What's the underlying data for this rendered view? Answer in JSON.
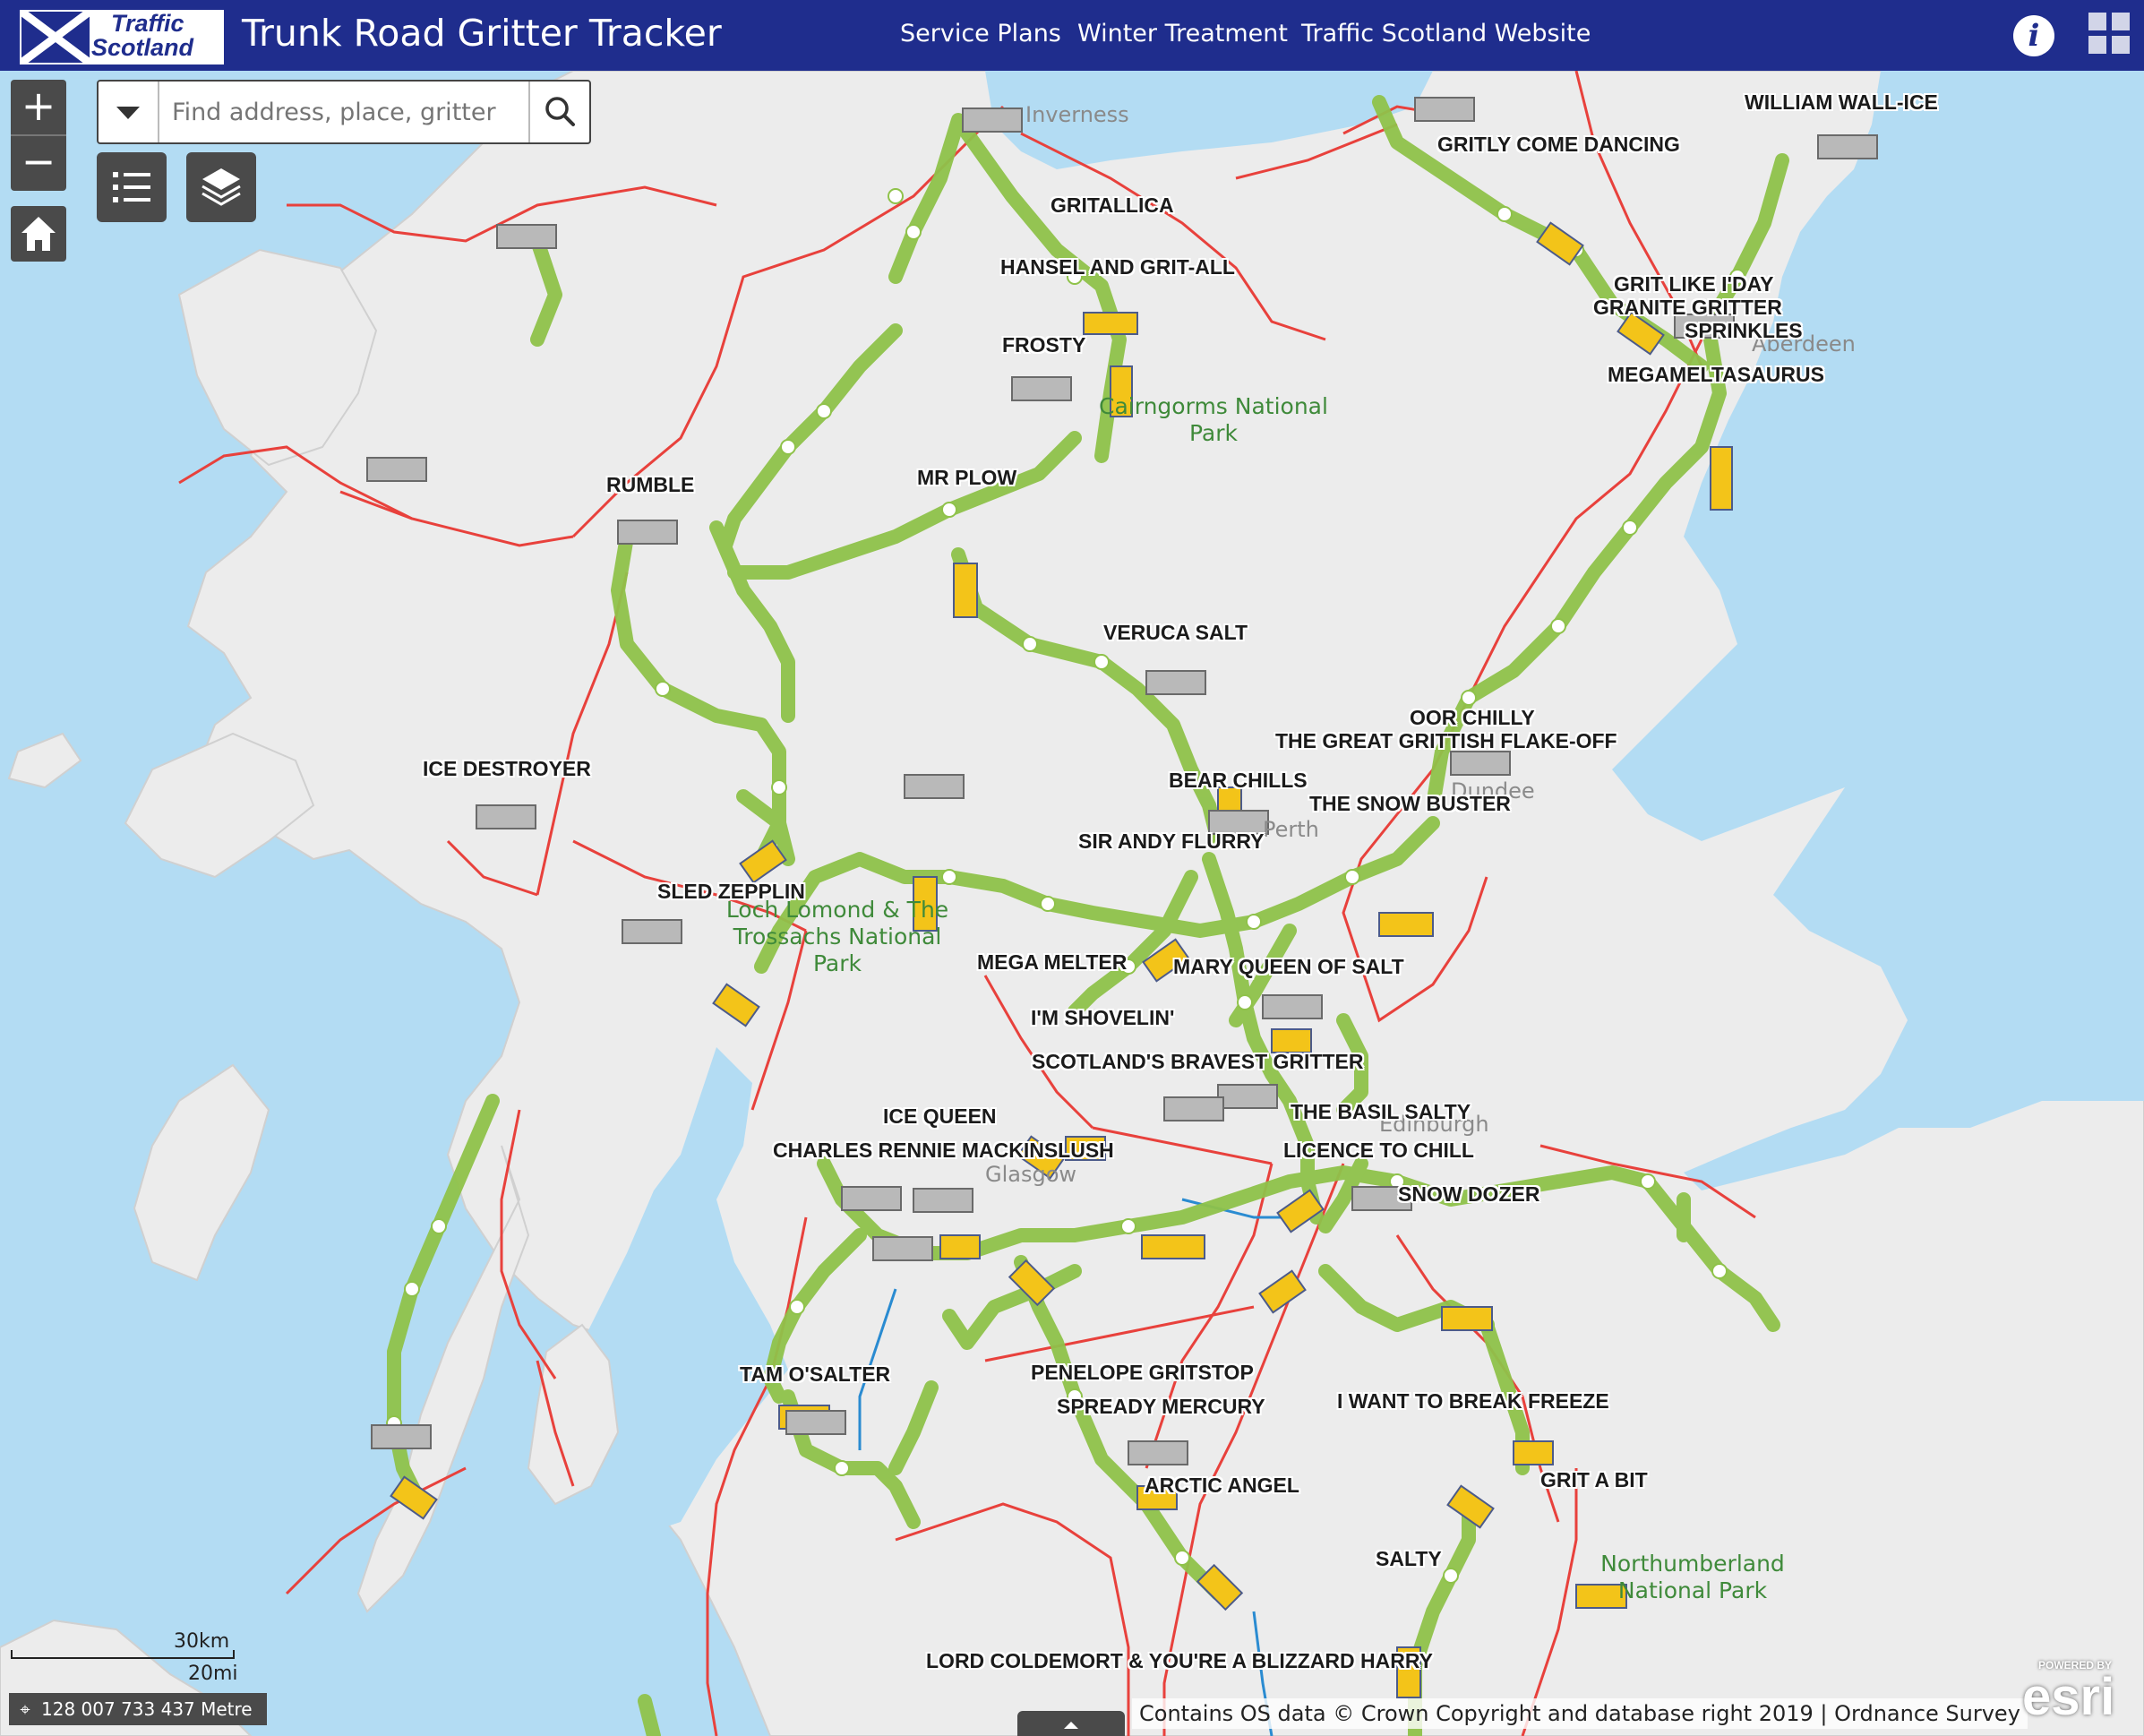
{
  "header": {
    "logo_line1": "Traffic",
    "logo_line2": "Scotland",
    "title": "Trunk Road Gritter Tracker",
    "nav": [
      "Service Plans",
      "Winter Treatment",
      "Traffic Scotland Website"
    ]
  },
  "search": {
    "placeholder": "Find address, place, gritter"
  },
  "icons": {
    "zoom_in": "plus-icon",
    "zoom_out": "minus-icon",
    "home": "home-icon",
    "legend": "list-icon",
    "layers": "layers-icon",
    "search": "search-icon",
    "dropdown": "chevron-down-icon",
    "info": "info-icon",
    "apps": "grid-icon"
  },
  "colors": {
    "header": "#1f2d8d",
    "water": "#b3dcf3",
    "land": "#ececec",
    "route": "#8fc24a",
    "road": "#e8413c",
    "gritter_active": "#f3c419",
    "gritter_idle": "#b9b9b9"
  },
  "gritters": [
    "WILLIAM WALL-ICE",
    "GRITLY COME DANCING",
    "GRITALLICA",
    "HANSEL AND GRIT-ALL",
    "FROSTY",
    "GRIT LIKE I'DAY",
    "GRANITE GRITTER",
    "SPRINKLES",
    "MEGAMELTASAURUS",
    "RUMBLE",
    "MR PLOW",
    "VERUCA SALT",
    "OOR CHILLY",
    "THE GREAT GRITTISH FLAKE-OFF",
    "BEAR CHILLS",
    "THE SNOW BUSTER",
    "ICE DESTROYER",
    "SIR ANDY FLURRY",
    "SLED ZEPPLIN",
    "MEGA MELTER",
    "MARY QUEEN OF SALT",
    "I'M SHOVELIN'",
    "SCOTLAND'S BRAVEST GRITTER",
    "THE BASIL SALTY",
    "ICE QUEEN",
    "CHARLES RENNIE MACKINSLUSH",
    "LICENCE TO CHILL",
    "SNOW DOZER",
    "TAM O'SALTER",
    "PENELOPE GRITSTOP",
    "SPREADY MERCURY",
    "I WANT TO BREAK FREEZE",
    "ARCTIC ANGEL",
    "GRIT A BIT",
    "SALTY",
    "LORD COLDEMORT & YOU'RE A BLIZZARD HARRY"
  ],
  "places": {
    "inverness": "Inverness",
    "aberdeen": "Aberdeen",
    "perth": "Perth",
    "dundee": "Dundee",
    "edinburgh": "Edinburgh",
    "glasgow": "Glasgow"
  },
  "parks": {
    "cairngorms": "Cairngorms National Park",
    "lochlomond": "Loch Lomond & The Trossachs National Park",
    "northumberland": "Northumberland National Park"
  },
  "scale": {
    "km": "30km",
    "mi": "20mi"
  },
  "coordinates": "128 007 733 437 Metre",
  "attribution": "Contains OS data © Crown Copyright and database right 2019 | Ordnance Survey",
  "esri": {
    "powered": "POWERED BY",
    "brand": "esri"
  }
}
